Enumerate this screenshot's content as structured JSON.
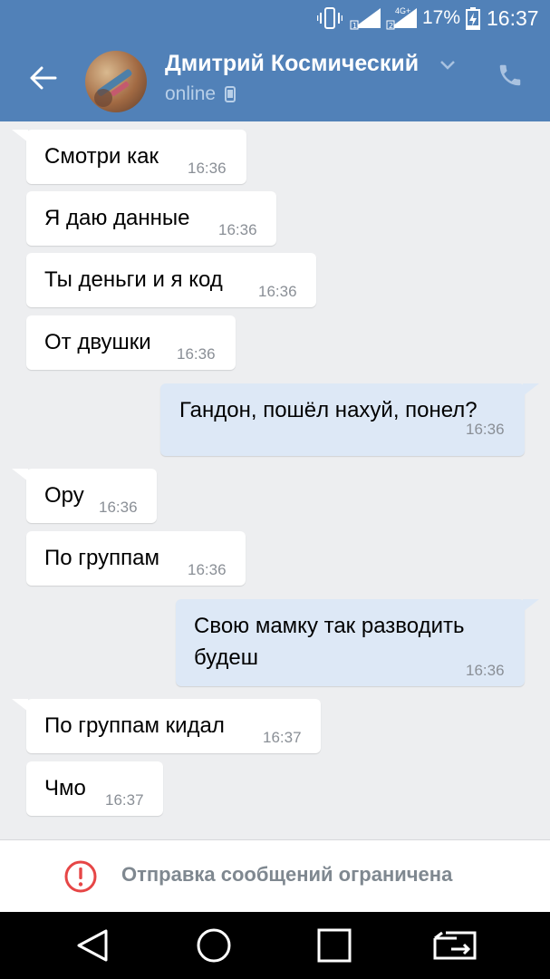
{
  "status_bar": {
    "battery_percent": "17%",
    "time": "16:37",
    "network": "4G+"
  },
  "chat": {
    "contact_name": "Дмитрий Космический",
    "status": "online"
  },
  "messages": [
    {
      "dir": "in",
      "text": "Смотри как",
      "time": "16:36"
    },
    {
      "dir": "in",
      "text": "Я даю данные",
      "time": "16:36"
    },
    {
      "dir": "in",
      "text": "Ты деньги и я код",
      "time": "16:36"
    },
    {
      "dir": "in",
      "text": "От двушки",
      "time": "16:36"
    },
    {
      "dir": "out",
      "text": "Гандон, пошёл нахуй, понел?",
      "time": "16:36"
    },
    {
      "dir": "in",
      "text": "Ору",
      "time": "16:36"
    },
    {
      "dir": "in",
      "text": "По группам",
      "time": "16:36"
    },
    {
      "dir": "out",
      "lines": [
        "Свою мамку так разводить",
        "будеш"
      ],
      "time": "16:36"
    },
    {
      "dir": "in",
      "text": "По группам кидал",
      "time": "16:37"
    },
    {
      "dir": "in",
      "text": "Чмо",
      "time": "16:37"
    }
  ],
  "restriction": {
    "text": "Отправка сообщений ограничена"
  },
  "colors": {
    "header": "#5181b8",
    "background": "#edeef0",
    "incoming": "#ffffff",
    "outgoing": "#dde8f6",
    "alert": "#e64646"
  }
}
